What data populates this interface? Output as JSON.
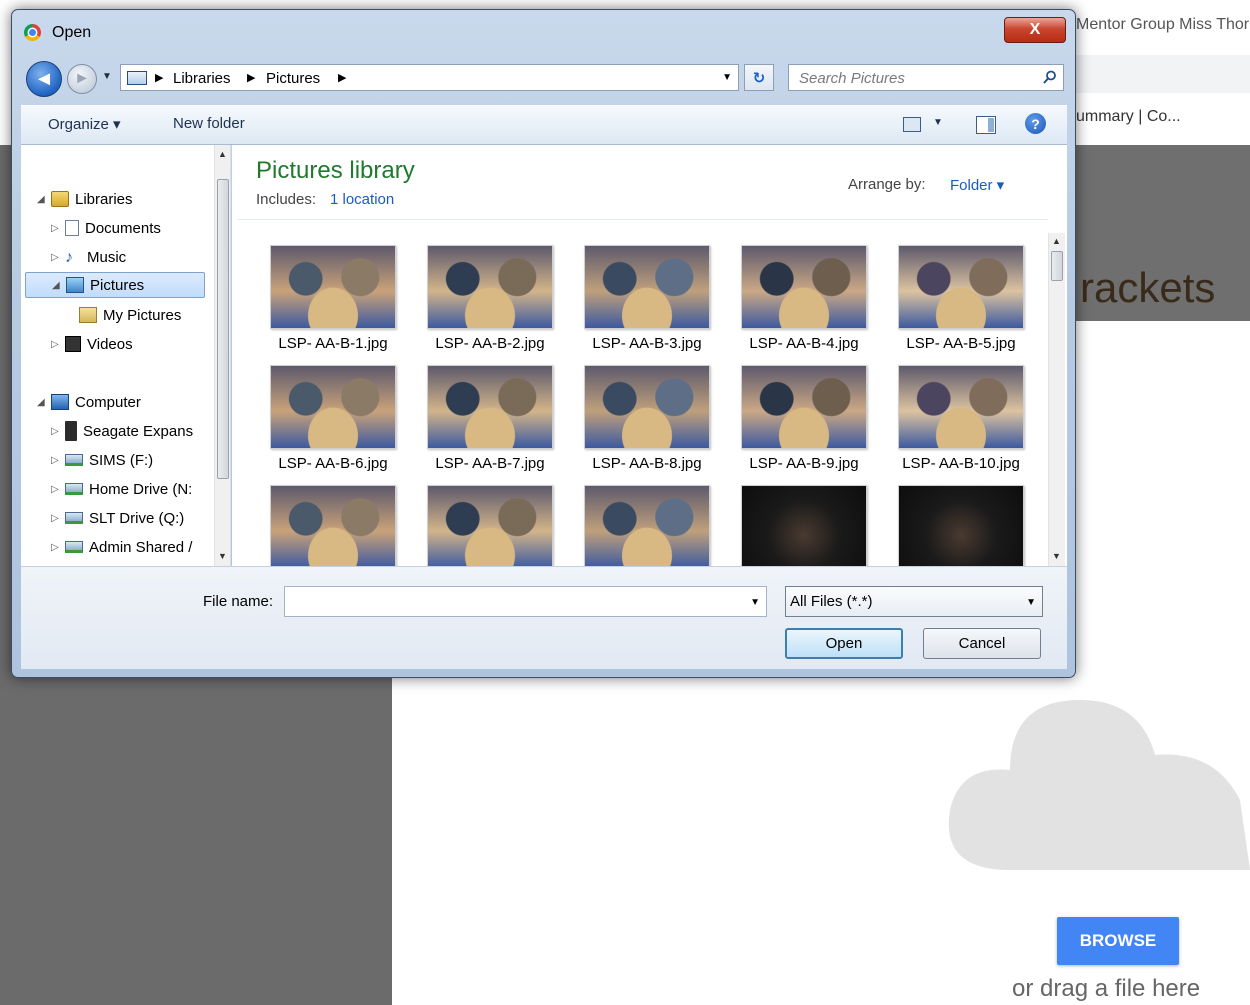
{
  "background": {
    "tab_text": "Mentor Group Miss Thor",
    "bookmark_text": "ummary | Co...",
    "page_title": "rackets",
    "browse_label": "BROWSE",
    "drag_text": "or drag a file here"
  },
  "dialog": {
    "title": "Open",
    "close_label": "X",
    "breadcrumb": [
      "Libraries",
      "Pictures"
    ],
    "search_placeholder": "Search Pictures",
    "toolbar": {
      "organize_label": "Organize ▾",
      "new_folder_label": "New folder",
      "help_label": "?"
    },
    "nav": {
      "items": [
        {
          "label": "Libraries",
          "icon": "library-icon"
        },
        {
          "label": "Documents",
          "icon": "documents-icon"
        },
        {
          "label": "Music",
          "icon": "music-icon"
        },
        {
          "label": "Pictures",
          "icon": "pictures-icon"
        },
        {
          "label": "My Pictures",
          "icon": "my-pictures-icon"
        },
        {
          "label": "Videos",
          "icon": "videos-icon"
        },
        {
          "label": "Computer",
          "icon": "computer-icon"
        },
        {
          "label": "Seagate Expans",
          "icon": "external-drive-icon"
        },
        {
          "label": "SIMS (F:)",
          "icon": "network-drive-icon"
        },
        {
          "label": "Home Drive (N:",
          "icon": "network-drive-icon"
        },
        {
          "label": "SLT Drive (Q:)",
          "icon": "network-drive-icon"
        },
        {
          "label": "Admin Shared /",
          "icon": "network-drive-icon"
        }
      ]
    },
    "content": {
      "library_title": "Pictures library",
      "includes_label": "Includes:",
      "location_link": "1 location",
      "arrange_label": "Arrange by:",
      "arrange_value": "Folder ▾",
      "files": [
        "LSP- AA-B-1.jpg",
        "LSP- AA-B-2.jpg",
        "LSP- AA-B-3.jpg",
        "LSP- AA-B-4.jpg",
        "LSP- AA-B-5.jpg",
        "LSP- AA-B-6.jpg",
        "LSP- AA-B-7.jpg",
        "LSP- AA-B-8.jpg",
        "LSP- AA-B-9.jpg",
        "LSP- AA-B-10.jpg",
        "",
        "",
        "",
        "",
        ""
      ]
    },
    "bottom": {
      "file_name_label": "File name:",
      "file_name_value": "",
      "file_type_value": "All Files (*.*)",
      "open_label": "Open",
      "cancel_label": "Cancel"
    },
    "colors": {
      "accent_blue": "#1a5cbf",
      "library_title_green": "#1f7a2d",
      "browse_blue": "#4285f4"
    }
  }
}
